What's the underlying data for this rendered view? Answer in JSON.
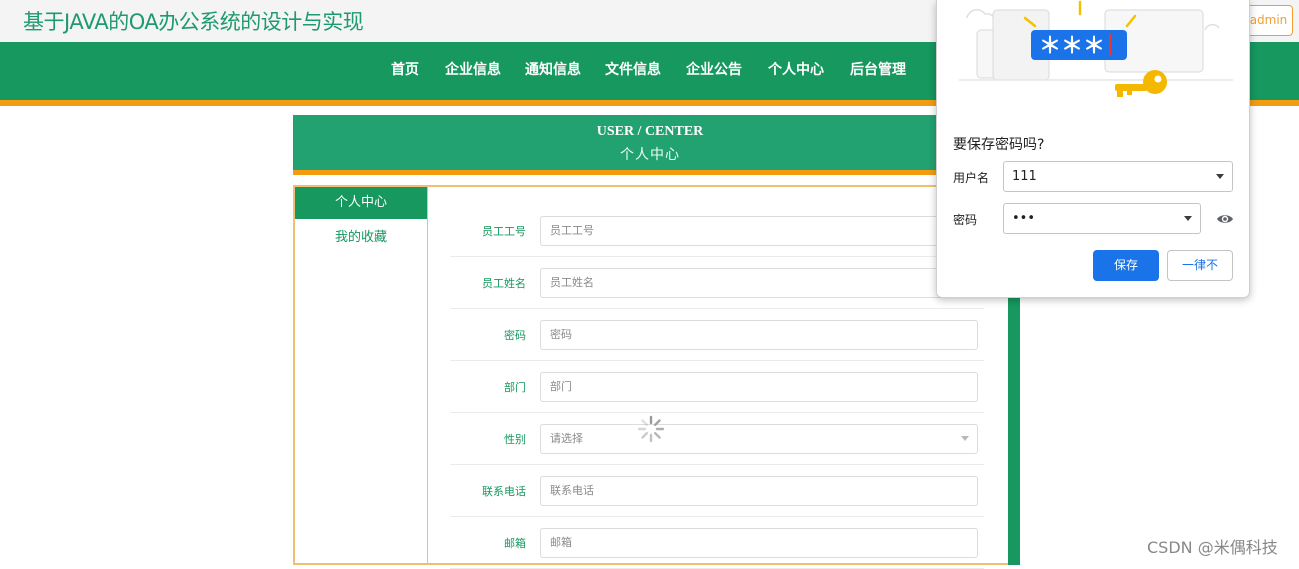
{
  "site": {
    "title": "基于JAVA的OA办公系统的设计与实现",
    "user_badge": "admin"
  },
  "nav": {
    "items": [
      {
        "label": "首页"
      },
      {
        "label": "企业信息"
      },
      {
        "label": "通知信息"
      },
      {
        "label": "文件信息"
      },
      {
        "label": "企业公告"
      },
      {
        "label": "个人中心"
      },
      {
        "label": "后台管理"
      }
    ]
  },
  "banner": {
    "english": "USER / CENTER",
    "chinese": "个人中心"
  },
  "sidebar": {
    "active": "个人中心",
    "items": [
      {
        "label": "我的收藏"
      }
    ]
  },
  "form": {
    "fields": [
      {
        "label": "员工工号",
        "placeholder": "员工工号",
        "type": "text"
      },
      {
        "label": "员工姓名",
        "placeholder": "员工姓名",
        "type": "text"
      },
      {
        "label": "密码",
        "placeholder": "密码",
        "type": "password"
      },
      {
        "label": "部门",
        "placeholder": "部门",
        "type": "text"
      },
      {
        "label": "性别",
        "placeholder": "请选择",
        "type": "select"
      },
      {
        "label": "联系电话",
        "placeholder": "联系电话",
        "type": "text"
      },
      {
        "label": "邮箱",
        "placeholder": "邮箱",
        "type": "text"
      }
    ]
  },
  "password_popup": {
    "question": "要保存密码吗?",
    "username_label": "用户名",
    "username_value": "111",
    "password_label": "密码",
    "password_value": "•••",
    "save_label": "保存",
    "never_label": "一律不",
    "illustration_mask": "＊＊＊"
  },
  "watermark": "CSDN @米偶科技",
  "colors": {
    "primary_green": "#16985f",
    "accent_orange": "#f39c12",
    "chrome_blue": "#1a73e8"
  }
}
